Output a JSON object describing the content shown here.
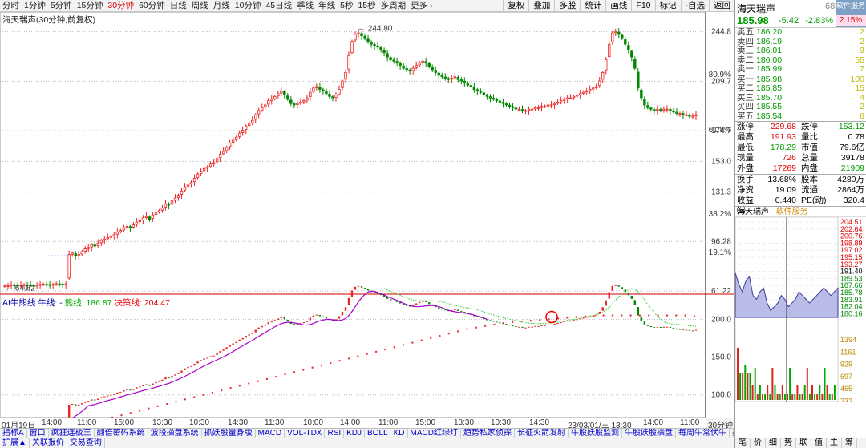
{
  "toolbar": {
    "timeframes": [
      "分时",
      "1分钟",
      "5分钟",
      "15分钟",
      "30分钟",
      "60分钟",
      "日线",
      "周线",
      "月线",
      "10分钟",
      "45日线",
      "季线",
      "年线",
      "5秒",
      "15秒",
      "多周期",
      "更多 ›"
    ],
    "active_index": 4,
    "tools": [
      "复权",
      "叠加",
      "多股",
      "统计",
      "画线",
      "F10",
      "标记",
      "-自选",
      "返回"
    ]
  },
  "main": {
    "title": "海天瑞声(30分钟,前复权)",
    "high_marker": "244.80",
    "low_marker": "64.82",
    "price_labels": [
      "244.8",
      "209.7",
      "174.7",
      "153.0",
      "131.3",
      "96.28",
      "61.22"
    ],
    "pct_labels": [
      "80.9%",
      "61.8%",
      "38.2%",
      "19.1%"
    ]
  },
  "indicator": {
    "name": "AI牛熊线",
    "bull_label": "牛线: -",
    "bear_label": "熊线: 186.87",
    "decision_label": "决策线: 204.47",
    "axis_labels": [
      "200.0",
      "150.0",
      "100.0"
    ]
  },
  "time_axis": {
    "labels": [
      "01月19日",
      "14:00",
      "11:00",
      "15:00",
      "13:30",
      "10:30",
      "14:30",
      "11:30",
      "10:00",
      "14:00",
      "11:00",
      "15:00",
      "13:30",
      "10:30",
      "14:30",
      "23/03/01/三 13:30",
      "14:00",
      "11:00"
    ],
    "period": "30分钟"
  },
  "indicator_tabs": [
    "指标A",
    "窗口",
    "疯狂连板王",
    "翻倍密码系统",
    "波段操盘系统",
    "抓妖股量身版",
    "MACD",
    "VOL-TDX",
    "RSI",
    "KDJ",
    "BOLL",
    "KD",
    "MACD红绿灯",
    "趋势私家侦探",
    "长征火箭发射",
    "牛股妖股监测",
    "牛股妖股操盘",
    "每周牛常伏牛"
  ],
  "indicator_tabs_right": [
    "指标B",
    "模 板",
    "↑",
    "+"
  ],
  "bottom_tabs": [
    "扩展▲",
    "关联报价",
    "交易查询"
  ],
  "quote": {
    "name": "海天瑞声",
    "code": "688",
    "badge": "软件服务",
    "badge_pct": "2.15%",
    "price": "185.98",
    "change": "-5.42",
    "change_pct": "-2.83%",
    "asks": [
      {
        "label": "卖五",
        "price": "186.20",
        "qty": "2"
      },
      {
        "label": "卖四",
        "price": "186.19",
        "qty": "2"
      },
      {
        "label": "卖三",
        "price": "186.01",
        "qty": "9"
      },
      {
        "label": "卖二",
        "price": "186.00",
        "qty": "55"
      },
      {
        "label": "卖一",
        "price": "185.99",
        "qty": "7"
      }
    ],
    "bids": [
      {
        "label": "买一",
        "price": "185.98",
        "qty": "100"
      },
      {
        "label": "买二",
        "price": "185.85",
        "qty": "15"
      },
      {
        "label": "买三",
        "price": "185.70",
        "qty": "4"
      },
      {
        "label": "买四",
        "price": "185.55",
        "qty": "2"
      },
      {
        "label": "买五",
        "price": "185.54",
        "qty": "6"
      }
    ],
    "stats": [
      {
        "k": "涨停",
        "v": "229.68",
        "k2": "跌停",
        "v2": "153.12"
      },
      {
        "k": "最高",
        "v": "191.93",
        "k2": "量比",
        "v2": "0.78"
      },
      {
        "k": "最低",
        "v": "178.29",
        "k2": "市值",
        "v2": "79.6亿"
      },
      {
        "k": "现量",
        "v": "726",
        "k2": "总量",
        "v2": "39178"
      },
      {
        "k": "外盘",
        "v": "17269",
        "k2": "内盘",
        "v2": "21909"
      }
    ],
    "stats2": [
      {
        "k": "换手",
        "v": "13.68%",
        "k2": "股本",
        "v2": "4280万"
      },
      {
        "k": "净资",
        "v": "19.09",
        "k2": "流通",
        "v2": "2864万"
      },
      {
        "k": "收益㈢",
        "v": "0.440",
        "k2": "PE(动)",
        "v2": "320.4"
      }
    ]
  },
  "mini": {
    "title": "海天瑞声",
    "subtitle": "软件服务",
    "price_labels": [
      "204.51",
      "202.64",
      "200.76",
      "198.89",
      "197.02",
      "195.15",
      "193.27",
      "191.40",
      "189.53",
      "187.66",
      "185.78",
      "183.91",
      "182.04",
      "180.16"
    ],
    "vol_labels": [
      "1394",
      "1161",
      "929",
      "697",
      "465",
      "232"
    ],
    "tabs": [
      "笔",
      "价",
      "细",
      "势",
      "联",
      "值",
      "主",
      "筹"
    ]
  },
  "chart_data": {
    "type": "candlestick",
    "title": "海天瑞声(30分钟,前复权)",
    "ylim": [
      61.22,
      252
    ],
    "closes": [
      64.8,
      65,
      65.5,
      65.3,
      64.9,
      65.2,
      65.6,
      65.4,
      65.1,
      64.9,
      65.3,
      65.8,
      66,
      65.7,
      65.5,
      65.9,
      66.3,
      66.1,
      65.8,
      66.2,
      87,
      88,
      86,
      87,
      89,
      91,
      92,
      94,
      93,
      95,
      97,
      98,
      99,
      100,
      101,
      103,
      104,
      106,
      107,
      106,
      108,
      110,
      111,
      113,
      114,
      112,
      115,
      117,
      118,
      120,
      123,
      122,
      125,
      127,
      129,
      132,
      135,
      137,
      138,
      141,
      144,
      146,
      148,
      149,
      151,
      152,
      155,
      158,
      160,
      163,
      166,
      168,
      170,
      173,
      175,
      178,
      180,
      182,
      186,
      189,
      191,
      193,
      196,
      197,
      199,
      201,
      203,
      200,
      197,
      194,
      193,
      194,
      195,
      196,
      198,
      202,
      205,
      206,
      204,
      203,
      201,
      199,
      198,
      200,
      204,
      210,
      216,
      228,
      238,
      243,
      244,
      242,
      240,
      238,
      236,
      235,
      234,
      232,
      230,
      227,
      225,
      224,
      223,
      221,
      219,
      218,
      217,
      219,
      221,
      223,
      224,
      223,
      220,
      218,
      216,
      214,
      213,
      212,
      211,
      212,
      213,
      211,
      210,
      209,
      207,
      206,
      204,
      203,
      202,
      200,
      199,
      198,
      197,
      196,
      195,
      194,
      193,
      192,
      191,
      190,
      190,
      189,
      189,
      190,
      190,
      191,
      191,
      192,
      192,
      193,
      193,
      194,
      195,
      196,
      197,
      198,
      198,
      199,
      200,
      201,
      202,
      203,
      204,
      205,
      206,
      210,
      216,
      225,
      236,
      244,
      245,
      243,
      240,
      236,
      232,
      227,
      219,
      205,
      198,
      193,
      191,
      190,
      189,
      190,
      189,
      190,
      190,
      189,
      188,
      187,
      187,
      186,
      186,
      185,
      185,
      186
    ],
    "decision_line": [
      35,
      37,
      40,
      43,
      46,
      49,
      52,
      55,
      58,
      61,
      64,
      67,
      70,
      73,
      76,
      79,
      82,
      85,
      88,
      91,
      94,
      97,
      100,
      103,
      106,
      109,
      112,
      115,
      118,
      121,
      124,
      127,
      130,
      133,
      136,
      139,
      142,
      145,
      148,
      151,
      154,
      157,
      160,
      163,
      166,
      169,
      172,
      175,
      178,
      181,
      184,
      187,
      189,
      191,
      193,
      195,
      196,
      197,
      198,
      199,
      200,
      201,
      202,
      203,
      204,
      204,
      205,
      205,
      205,
      205,
      205,
      205,
      205,
      205,
      205,
      205,
      204
    ]
  }
}
